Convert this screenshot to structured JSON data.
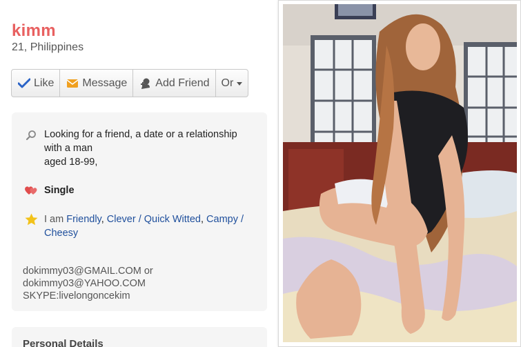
{
  "profile": {
    "name": "kimm",
    "subtitle": "21, Philippines"
  },
  "actions": {
    "like": "Like",
    "message": "Message",
    "add_friend": "Add Friend",
    "or": "Or"
  },
  "about": {
    "looking_line1": "Looking for a friend, a date or a relationship",
    "looking_line2": "with a man",
    "looking_line3": "aged 18-99,",
    "status": "Single",
    "i_am_prefix": "I am",
    "traits": [
      "Friendly",
      "Clever / Quick Witted",
      "Campy /",
      "Cheesy"
    ],
    "contact_line1": "dokimmy03@GMAIL.COM or",
    "contact_line2": "dokimmy03@YAHOO.COM",
    "contact_line3": "SKYPE:livelongoncekim"
  },
  "details": {
    "heading": "Personal Details"
  },
  "icons": {
    "like": "checkmark-icon",
    "message": "envelope-icon",
    "add_friend": "person-icon",
    "looking": "search-icon",
    "status": "hearts-icon",
    "traits": "star-icon"
  },
  "colors": {
    "name": "#e86060",
    "link": "#1f4f9c",
    "check": "#2a63c7",
    "envelope": "#f0a020",
    "heart": "#e04c4c",
    "star": "#f2c21a"
  }
}
